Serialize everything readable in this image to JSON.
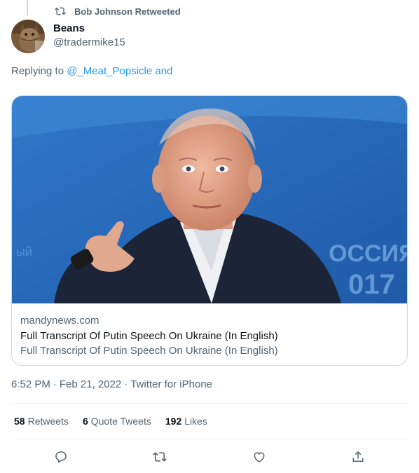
{
  "retweet": {
    "label": "Bob Johnson Retweeted",
    "icon": "retweet-icon"
  },
  "author": {
    "name": "Beans",
    "handle": "@tradermike15",
    "avatar_icon": "cat-avatar"
  },
  "reply": {
    "prefix": "Replying to ",
    "mention": "@_Meat_Popsicle",
    "suffix": " and"
  },
  "card": {
    "image_icon": "man-pointing-photo",
    "domain": "mandynews.com",
    "title": "Full Transcript Of Putin Speech On Ukraine (In English)",
    "description": "Full Transcript Of Putin Speech On Ukraine (In English)",
    "photo_background_text_1": "ОССИЯ",
    "photo_background_text_2": "017"
  },
  "meta": {
    "time": "6:52 PM",
    "separator": "·",
    "date": "Feb 21, 2022",
    "source": "Twitter for iPhone"
  },
  "stats": {
    "retweets_count": "58",
    "retweets_label": "Retweets",
    "quotes_count": "6",
    "quotes_label": "Quote Tweets",
    "likes_count": "192",
    "likes_label": "Likes"
  },
  "actions": {
    "reply_icon": "reply-icon",
    "retweet_icon": "retweet-icon",
    "like_icon": "heart-icon",
    "share_icon": "share-icon"
  },
  "colors": {
    "accent": "#1d9bf0",
    "muted": "#536471",
    "text": "#0f1419",
    "border": "#cfd9de"
  }
}
